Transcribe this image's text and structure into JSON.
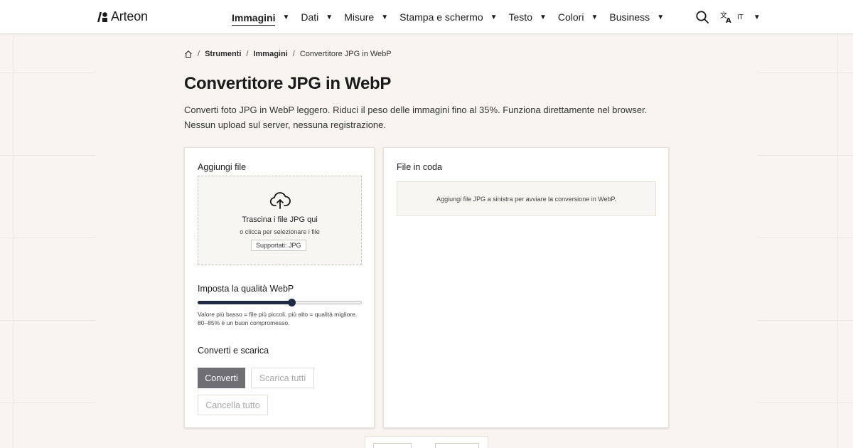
{
  "brand": {
    "name": "Arteon"
  },
  "nav": {
    "items": [
      {
        "label": "Immagini",
        "active": true
      },
      {
        "label": "Dati"
      },
      {
        "label": "Misure"
      },
      {
        "label": "Stampa e schermo"
      },
      {
        "label": "Testo"
      },
      {
        "label": "Colori"
      },
      {
        "label": "Business"
      }
    ],
    "caret": "▼"
  },
  "language": {
    "code": "IT"
  },
  "breadcrumb": {
    "sep": "/",
    "items": [
      "Strumenti",
      "Immagini"
    ],
    "current": "Convertitore JPG in WebP"
  },
  "page": {
    "title": "Convertitore JPG in WebP",
    "description": "Converti foto JPG in WebP leggero. Riduci il peso delle immagini fino al 35%. Funziona direttamente nel browser. Nessun upload sul server, nessuna registrazione."
  },
  "upload": {
    "title": "Aggiungi file",
    "drop_title": "Trascina i file JPG qui",
    "drop_sub": "o clicca per selezionare i file",
    "supported": "Supportati: JPG"
  },
  "quality": {
    "title": "Imposta la qualità WebP",
    "value_fraction": 0.57,
    "help": "Valore più basso = file più piccoli, più alto = qualità migliore. 80–85% è un buon compromesso."
  },
  "actions": {
    "title": "Converti e scarica",
    "convert": "Converti",
    "download_all": "Scarica tutti",
    "clear_all": "Cancella tutto"
  },
  "queue": {
    "title": "File in coda",
    "empty": "Aggiungi file JPG a sinistra per avviare la conversione in WebP."
  },
  "colors": {
    "accent": "#1f2a44",
    "primary_button": "#6e6e74"
  }
}
